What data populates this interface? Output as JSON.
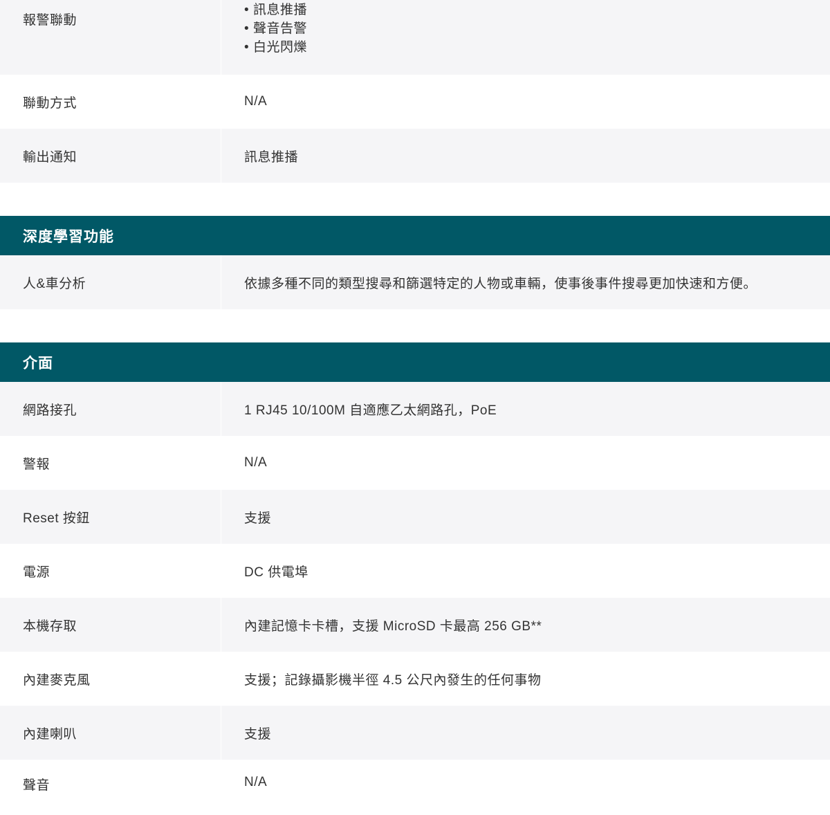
{
  "alarm_section": {
    "rows": [
      {
        "label": "報警聯動",
        "items": [
          "訊息推播",
          "聲音告警",
          "白光閃爍"
        ]
      },
      {
        "label": "聯動方式",
        "value": "N/A"
      },
      {
        "label": "輸出通知",
        "value": "訊息推播"
      }
    ]
  },
  "deep_learning": {
    "title": "深度學習功能",
    "rows": [
      {
        "label": "人&車分析",
        "value": "依據多種不同的類型搜尋和篩選特定的人物或車輛，使事後事件搜尋更加快速和方便。"
      }
    ]
  },
  "interface": {
    "title": "介面",
    "rows": [
      {
        "label": "網路接孔",
        "value": "1 RJ45 10/100M 自適應乙太網路孔，PoE"
      },
      {
        "label": "警報",
        "value": "N/A"
      },
      {
        "label": "Reset 按鈕",
        "value": "支援"
      },
      {
        "label": "電源",
        "value": "DC 供電埠"
      },
      {
        "label": "本機存取",
        "value": "內建記憶卡卡槽，支援 MicroSD 卡最高 256 GB**"
      },
      {
        "label": "內建麥克風",
        "value": "支援；記錄攝影機半徑 4.5 公尺內發生的任何事物"
      },
      {
        "label": "內建喇叭",
        "value": "支援"
      },
      {
        "label": "聲音",
        "value": "N/A"
      }
    ]
  }
}
